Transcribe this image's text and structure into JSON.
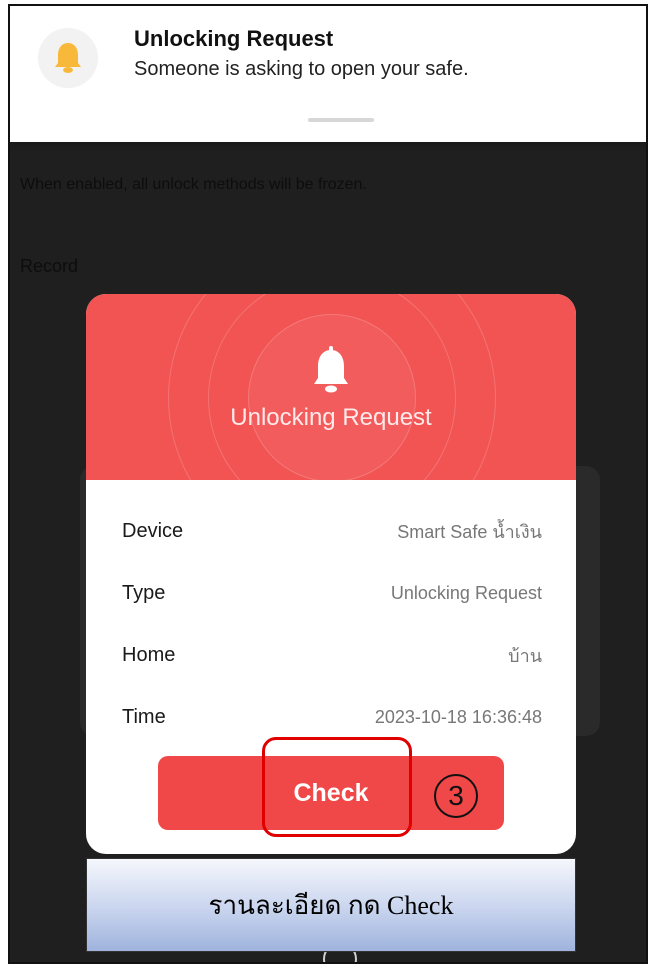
{
  "notification": {
    "title": "Unlocking Request",
    "subtitle": "Someone is asking to open your safe."
  },
  "background": {
    "hint_text": "When enabled, all unlock methods will be frozen.",
    "record_label": "Record"
  },
  "modal": {
    "title": "Unlocking Request",
    "rows": [
      {
        "label": "Device",
        "value": "Smart Safe น้ำเงิน"
      },
      {
        "label": "Type",
        "value": "Unlocking Request"
      },
      {
        "label": "Home",
        "value": "บ้าน"
      },
      {
        "label": "Time",
        "value": "2023-10-18 16:36:48"
      }
    ],
    "check_button": "Check"
  },
  "annotation": {
    "step_number": "3",
    "caption": "รานละเอียด กด Check"
  },
  "colors": {
    "accent_red": "#f25454",
    "button_red": "#f04848",
    "bell_yellow": "#f8b93a",
    "highlight_red": "#e00000"
  },
  "icons": [
    "bell-icon",
    "bell-icon-white"
  ]
}
